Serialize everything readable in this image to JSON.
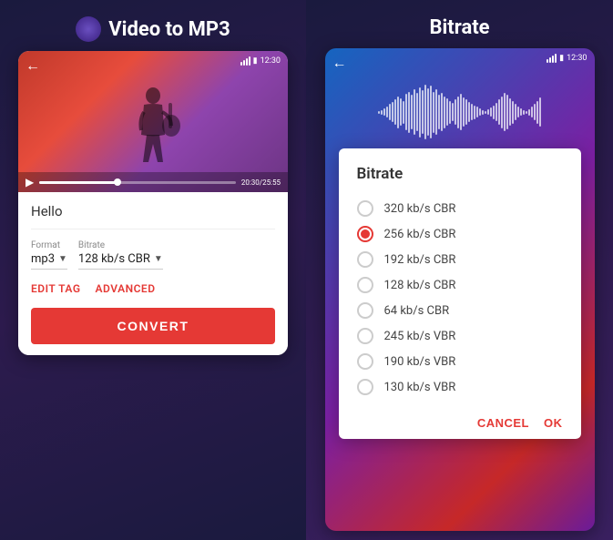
{
  "left": {
    "title": "Video to MP3",
    "statusBar": {
      "time": "12:30",
      "battery": "▮",
      "signal": "▲"
    },
    "video": {
      "timeDisplay": "20:30/25:55"
    },
    "form": {
      "fileName": "Hello",
      "formatLabel": "Format",
      "formatValue": "mp3",
      "bitrateLabel": "Bitrate",
      "bitrateValue": "128 kb/s CBR",
      "editTagLabel": "EDIT TAG",
      "advancedLabel": "ADVANCED",
      "convertLabel": "CONVERT"
    }
  },
  "right": {
    "title": "Bitrate",
    "statusBar": {
      "time": "12:30"
    },
    "dialog": {
      "title": "Bitrate",
      "options": [
        {
          "label": "320 kb/s CBR",
          "selected": false
        },
        {
          "label": "256 kb/s CBR",
          "selected": true
        },
        {
          "label": "192 kb/s CBR",
          "selected": false
        },
        {
          "label": "128 kb/s CBR",
          "selected": false
        },
        {
          "label": "64   kb/s CBR",
          "selected": false
        },
        {
          "label": "245 kb/s VBR",
          "selected": false
        },
        {
          "label": "190 kb/s VBR",
          "selected": false
        },
        {
          "label": "130 kb/s VBR",
          "selected": false
        }
      ],
      "cancelLabel": "CANCEL",
      "okLabel": "OK"
    }
  },
  "waveBars": [
    3,
    5,
    8,
    12,
    18,
    22,
    28,
    35,
    30,
    25,
    40,
    45,
    38,
    50,
    42,
    55,
    48,
    60,
    52,
    58,
    45,
    50,
    38,
    42,
    35,
    30,
    25,
    20,
    28,
    35,
    40,
    32,
    28,
    22,
    18,
    15,
    12,
    8,
    5,
    3,
    6,
    10,
    15,
    20,
    28,
    35,
    42,
    38,
    30,
    25,
    18,
    12,
    8,
    5,
    3,
    7,
    12,
    18,
    25,
    32
  ]
}
